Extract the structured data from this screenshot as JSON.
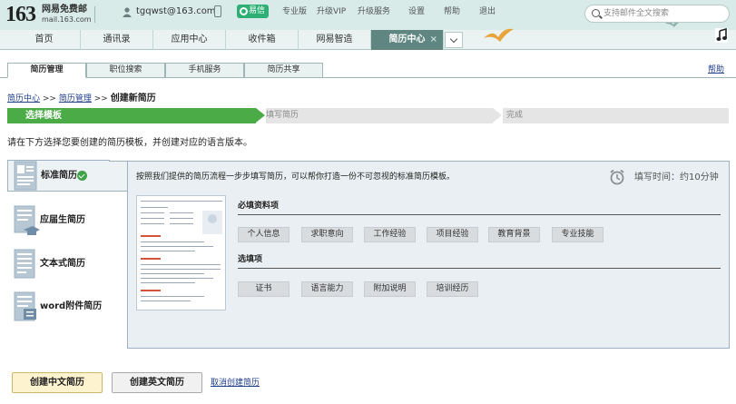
{
  "header": {
    "logo_number": "163",
    "logo_name": "网易免费邮",
    "logo_domain": "mail.163.com",
    "user_email": "tgqwst@163.com",
    "yixin_label": "易信",
    "nav": [
      "专业版",
      "升级VIP",
      "升级服务",
      "设置",
      "帮助",
      "退出"
    ],
    "search_placeholder": "支持邮件全文搜索"
  },
  "main_tabs": [
    "首页",
    "通讯录",
    "应用中心",
    "收件箱",
    "网易智造",
    "简历中心"
  ],
  "active_tab_close": "×",
  "sub_tabs": [
    "简历管理",
    "职位搜索",
    "手机服务",
    "简历共享"
  ],
  "help_label": "帮助",
  "breadcrumb": {
    "item1": "简历中心",
    "sep1": ">>",
    "item2": "简历管理",
    "sep2": ">>",
    "current": "创建新简历"
  },
  "steps": [
    "选择模板",
    "填写简历",
    "完成"
  ],
  "intro": "请在下方选择您要创建的简历模板，并创建对应的语言版本。",
  "template_types": [
    "标准简历",
    "应届生简历",
    "文本式简历",
    "word附件简历"
  ],
  "panel": {
    "description": "按照我们提供的简历流程一步步填写简历，可以帮你打造一份不可忽视的标准简历模板。",
    "fill_time": "填写时间：约10分钟",
    "required_title": "必填资料项",
    "required_items": [
      "个人信息",
      "求职意向",
      "工作经验",
      "项目经验",
      "教育背景",
      "专业技能"
    ],
    "optional_title": "选填项",
    "optional_items": [
      "证书",
      "语言能力",
      "附加说明",
      "培训经历"
    ]
  },
  "actions": {
    "create_cn": "创建中文简历",
    "create_en": "创建英文简历",
    "cancel": "取消创建简历"
  },
  "colors": {
    "step_active": "#4aab47",
    "active_tab": "#5f8681",
    "link": "#1f3e8c"
  }
}
